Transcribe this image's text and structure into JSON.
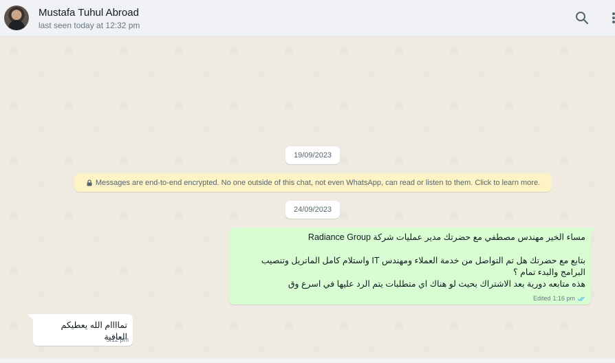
{
  "header": {
    "contact_name": "Mustafa Tuhul Abroad",
    "status": "last seen today at 12:32 pm",
    "icons": [
      "search-icon",
      "menu-icon"
    ]
  },
  "chat": {
    "date_1": "19/09/2023",
    "encryption_notice": "Messages are end-to-end encrypted. No one outside of this chat, not even WhatsApp, can read or listen to them. Click to learn more.",
    "date_2": "24/09/2023",
    "outgoing": {
      "text": "مساء الخير مهندس مصطفي مع حضرتك مدير عمليات شركة Radiance Group\n\nبتابع مع حضرتك هل تم التواصل من خدمة العملاء ومهندس IT واستلام كامل الماتريل وتنصيب البرامج والبدء تمام ؟\nهذه متابعه دورية بعد الاشتراك بحيث لو هناك اي متطلبات يتم الرد عليها في اسرع وق",
      "edited_label": "Edited",
      "time": "1:16 pm",
      "status_icon": "double-check-icon"
    },
    "incoming": {
      "text": "تماااام الله يعطيكم العافية",
      "time": "5:12 pm"
    }
  },
  "colors": {
    "header_bg": "#f0f2f5",
    "chat_bg": "#efeae2",
    "outgoing_bubble": "#d9fdd3",
    "incoming_bubble": "#ffffff",
    "notice_bg": "#fdf3c5",
    "tick_blue": "#53bdeb"
  }
}
